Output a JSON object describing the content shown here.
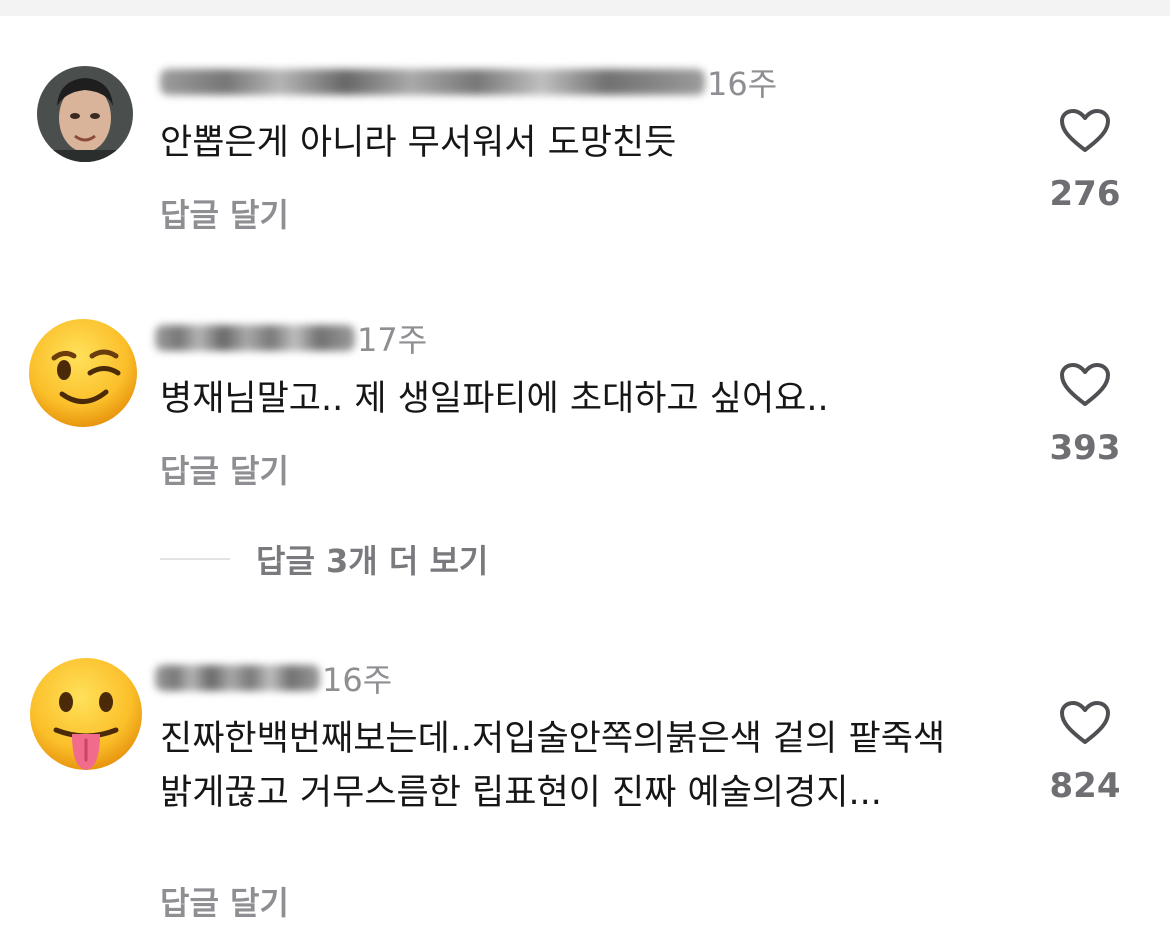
{
  "comments": [
    {
      "time": "16주",
      "text": "안뽑은게 아니라 무서워서 도망친듯",
      "reply_label": "답글 달기",
      "likes": "276",
      "avatar": "user-photo"
    },
    {
      "time": "17주",
      "text": "병재님말고.. 제 생일파티에 초대하고 싶어요..",
      "reply_label": "답글 달기",
      "likes": "393",
      "avatar": "winking-face-emoji",
      "more_replies": "답글 3개 더 보기"
    },
    {
      "time": "16주",
      "text": "진짜한백번째보는데..저입술안쪽의붉은색 겉의 팥죽색 밝게끊고 거무스름한 립표현이 진짜 예술의경지...",
      "reply_label": "답글 달기",
      "likes": "824",
      "avatar": "face-with-tongue-emoji"
    }
  ],
  "icons": {
    "like": "heart-outline-icon"
  },
  "colors": {
    "secondary_text": "#8e8e93",
    "primary_text": "#161616",
    "background": "#ffffff"
  }
}
